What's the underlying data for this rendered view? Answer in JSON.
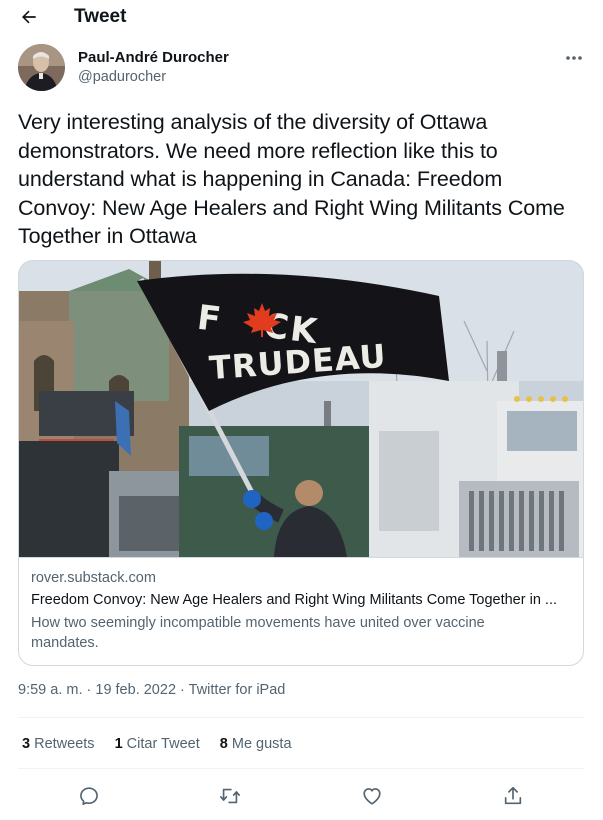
{
  "header": {
    "title": "Tweet",
    "back_icon": "arrow-left-icon"
  },
  "author": {
    "name": "Paul-André Durocher",
    "handle": "@padurocher",
    "more_icon": "more-dots-icon"
  },
  "tweet": {
    "text": "Very interesting analysis of the diversity of Ottawa demonstrators. We need more reflection like this to understand what is happening in Canada: Freedom Convoy: New Age Healers and Right Wing Militants Come Together in Ottawa"
  },
  "card": {
    "image_flag_text_1": "F   CK",
    "image_flag_text_2": "TRUDEAU",
    "domain": "rover.substack.com",
    "title": "Freedom Convoy: New Age Healers and Right Wing Militants Come Together in ...",
    "description": "How two seemingly incompatible movements have united over vaccine mandates."
  },
  "meta": {
    "time": "9:59 a. m.",
    "separator": " · ",
    "date": "19 feb. 2022",
    "source": "Twitter for iPad"
  },
  "stats": {
    "retweets_count": "3",
    "retweets_label": "Retweets",
    "quotes_count": "1",
    "quotes_label": "Citar Tweet",
    "likes_count": "8",
    "likes_label": "Me gusta"
  },
  "colors": {
    "text_primary": "#0f1419",
    "text_secondary": "#536471",
    "border": "#cfd9de",
    "divider": "#eff3f4"
  }
}
